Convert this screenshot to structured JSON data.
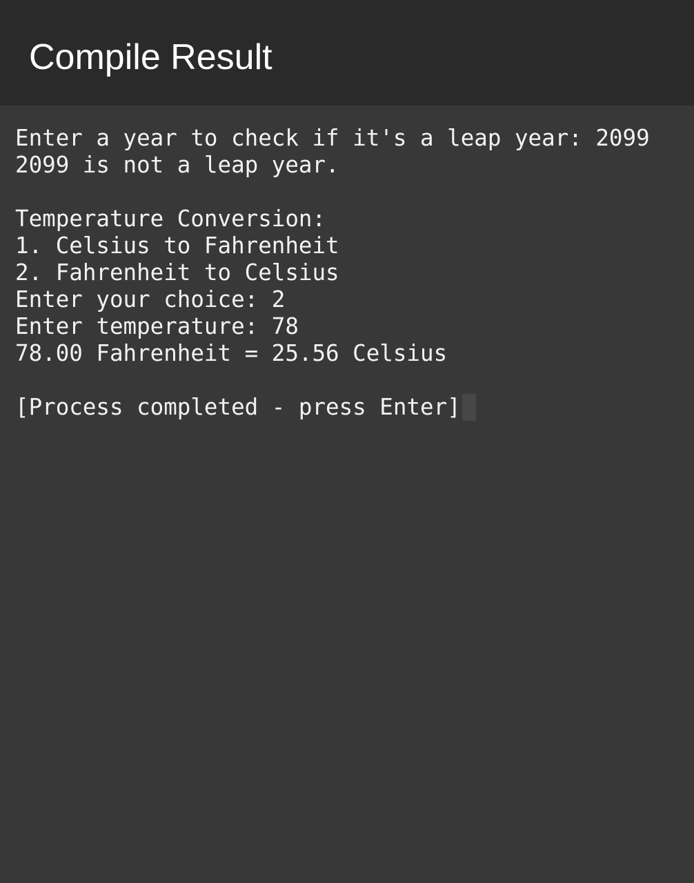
{
  "header": {
    "title": "Compile Result"
  },
  "console": {
    "lines": [
      "Enter a year to check if it's a leap year: 2099",
      "2099 is not a leap year.",
      "",
      "Temperature Conversion:",
      "1. Celsius to Fahrenheit",
      "2. Fahrenheit to Celsius",
      "Enter your choice: 2",
      "Enter temperature: 78",
      "78.00 Fahrenheit = 25.56 Celsius",
      "",
      "[Process completed - press Enter]"
    ]
  },
  "colors": {
    "header_background": "#2a2a2a",
    "console_background": "#383838",
    "text": "#f2f2f2",
    "cursor": "#474747"
  }
}
